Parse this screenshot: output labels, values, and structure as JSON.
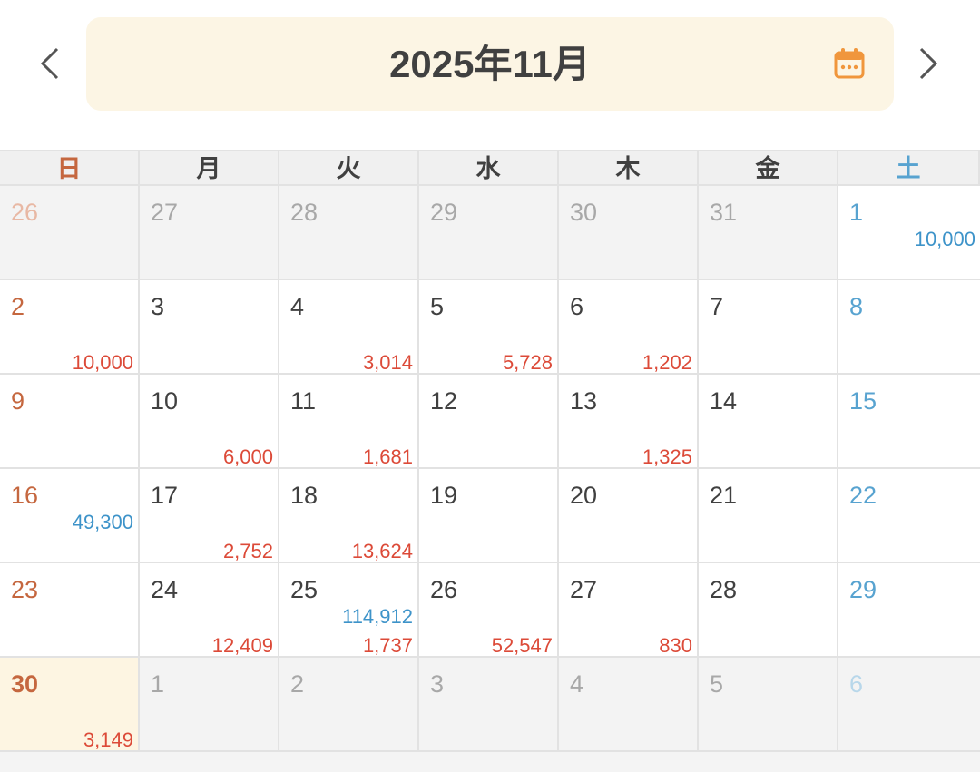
{
  "header": {
    "title": "2025年11月",
    "colors": {
      "pill": "#fcf5e4",
      "icon": "#f0963c",
      "arrow": "#555555"
    }
  },
  "weekdays": [
    "日",
    "月",
    "火",
    "水",
    "木",
    "金",
    "土"
  ],
  "weeks": [
    [
      {
        "day": "26",
        "out": true
      },
      {
        "day": "27",
        "out": true
      },
      {
        "day": "28",
        "out": true
      },
      {
        "day": "29",
        "out": true
      },
      {
        "day": "30",
        "out": true
      },
      {
        "day": "31",
        "out": true
      },
      {
        "day": "1",
        "income": "10,000"
      }
    ],
    [
      {
        "day": "2",
        "expense": "10,000"
      },
      {
        "day": "3"
      },
      {
        "day": "4",
        "expense": "3,014"
      },
      {
        "day": "5",
        "expense": "5,728"
      },
      {
        "day": "6",
        "expense": "1,202"
      },
      {
        "day": "7"
      },
      {
        "day": "8"
      }
    ],
    [
      {
        "day": "9"
      },
      {
        "day": "10",
        "expense": "6,000"
      },
      {
        "day": "11",
        "expense": "1,681"
      },
      {
        "day": "12"
      },
      {
        "day": "13",
        "expense": "1,325"
      },
      {
        "day": "14"
      },
      {
        "day": "15"
      }
    ],
    [
      {
        "day": "16",
        "income": "49,300"
      },
      {
        "day": "17",
        "expense": "2,752"
      },
      {
        "day": "18",
        "expense": "13,624"
      },
      {
        "day": "19"
      },
      {
        "day": "20"
      },
      {
        "day": "21"
      },
      {
        "day": "22"
      }
    ],
    [
      {
        "day": "23"
      },
      {
        "day": "24",
        "expense": "12,409"
      },
      {
        "day": "25",
        "income": "114,912",
        "expense": "1,737"
      },
      {
        "day": "26",
        "expense": "52,547"
      },
      {
        "day": "27",
        "expense": "830"
      },
      {
        "day": "28"
      },
      {
        "day": "29"
      }
    ],
    [
      {
        "day": "30",
        "today": true,
        "expense": "3,149"
      },
      {
        "day": "1",
        "out": true
      },
      {
        "day": "2",
        "out": true
      },
      {
        "day": "3",
        "out": true
      },
      {
        "day": "4",
        "out": true
      },
      {
        "day": "5",
        "out": true
      },
      {
        "day": "6",
        "out": true
      }
    ]
  ],
  "colors": {
    "sunday": "#c5673f",
    "saturday": "#58a3d0",
    "income": "#3d93c9",
    "expense": "#dc4a38",
    "today_bg": "#fdf5e2"
  }
}
